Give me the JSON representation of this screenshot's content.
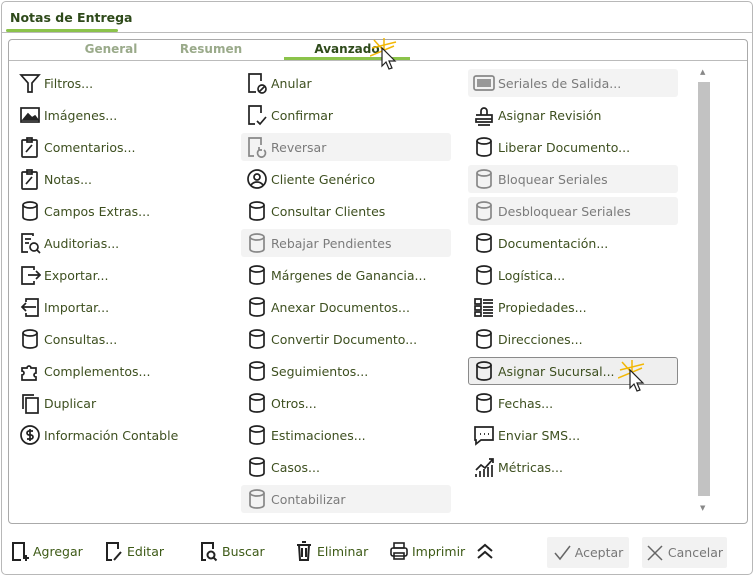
{
  "window": {
    "title": "Notas de Entrega"
  },
  "tabs": [
    {
      "label": "General"
    },
    {
      "label": "Resumen"
    },
    {
      "label": "Avanzado",
      "active": true
    }
  ],
  "columns": [
    [
      {
        "label": "Filtros...",
        "icon": "filter"
      },
      {
        "label": "Imágenes...",
        "icon": "image"
      },
      {
        "label": "Comentarios...",
        "icon": "clipboard"
      },
      {
        "label": "Notas...",
        "icon": "clipboard"
      },
      {
        "label": "Campos Extras...",
        "icon": "database"
      },
      {
        "label": "Auditorias...",
        "icon": "audit"
      },
      {
        "label": "Exportar...",
        "icon": "export"
      },
      {
        "label": "Importar...",
        "icon": "import"
      },
      {
        "label": "Consultas...",
        "icon": "database"
      },
      {
        "label": "Complementos...",
        "icon": "puzzle"
      },
      {
        "label": "Duplicar",
        "icon": "copy"
      },
      {
        "label": "Información Contable",
        "icon": "dollar"
      }
    ],
    [
      {
        "label": "Anular",
        "icon": "doc-cancel"
      },
      {
        "label": "Confirmar",
        "icon": "doc-check"
      },
      {
        "label": "Reversar",
        "icon": "doc-undo",
        "disabled": true
      },
      {
        "label": "Cliente Genérico",
        "icon": "user-circle"
      },
      {
        "label": "Consultar Clientes",
        "icon": "database"
      },
      {
        "label": "Rebajar Pendientes",
        "icon": "database",
        "disabled": true
      },
      {
        "label": "Márgenes de Ganancia...",
        "icon": "database"
      },
      {
        "label": "Anexar Documentos...",
        "icon": "database"
      },
      {
        "label": "Convertir Documento...",
        "icon": "database"
      },
      {
        "label": "Seguimientos...",
        "icon": "database"
      },
      {
        "label": "Otros...",
        "icon": "database"
      },
      {
        "label": "Estimaciones...",
        "icon": "database"
      },
      {
        "label": "Casos...",
        "icon": "database"
      },
      {
        "label": "Contabilizar",
        "icon": "database",
        "disabled": true
      }
    ],
    [
      {
        "label": "Seriales de Salida...",
        "icon": "barcode",
        "disabled": true
      },
      {
        "label": "Asignar Revisión",
        "icon": "stamp"
      },
      {
        "label": "Liberar Documento...",
        "icon": "database"
      },
      {
        "label": "Bloquear Seriales",
        "icon": "database",
        "disabled": true
      },
      {
        "label": "Desbloquear Seriales",
        "icon": "database",
        "disabled": true
      },
      {
        "label": "Documentación...",
        "icon": "database"
      },
      {
        "label": "Logística...",
        "icon": "database"
      },
      {
        "label": "Propiedades...",
        "icon": "grid-list"
      },
      {
        "label": "Direcciones...",
        "icon": "database"
      },
      {
        "label": "Asignar Sucursal...",
        "icon": "database",
        "hover": true
      },
      {
        "label": "Fechas...",
        "icon": "database"
      },
      {
        "label": "Enviar SMS...",
        "icon": "chat"
      },
      {
        "label": "Métricas...",
        "icon": "metrics"
      }
    ]
  ],
  "toolbar": {
    "add": "Agregar",
    "edit": "Editar",
    "search": "Buscar",
    "delete": "Eliminar",
    "print": "Imprimir",
    "accept": "Aceptar",
    "cancel": "Cancelar"
  }
}
